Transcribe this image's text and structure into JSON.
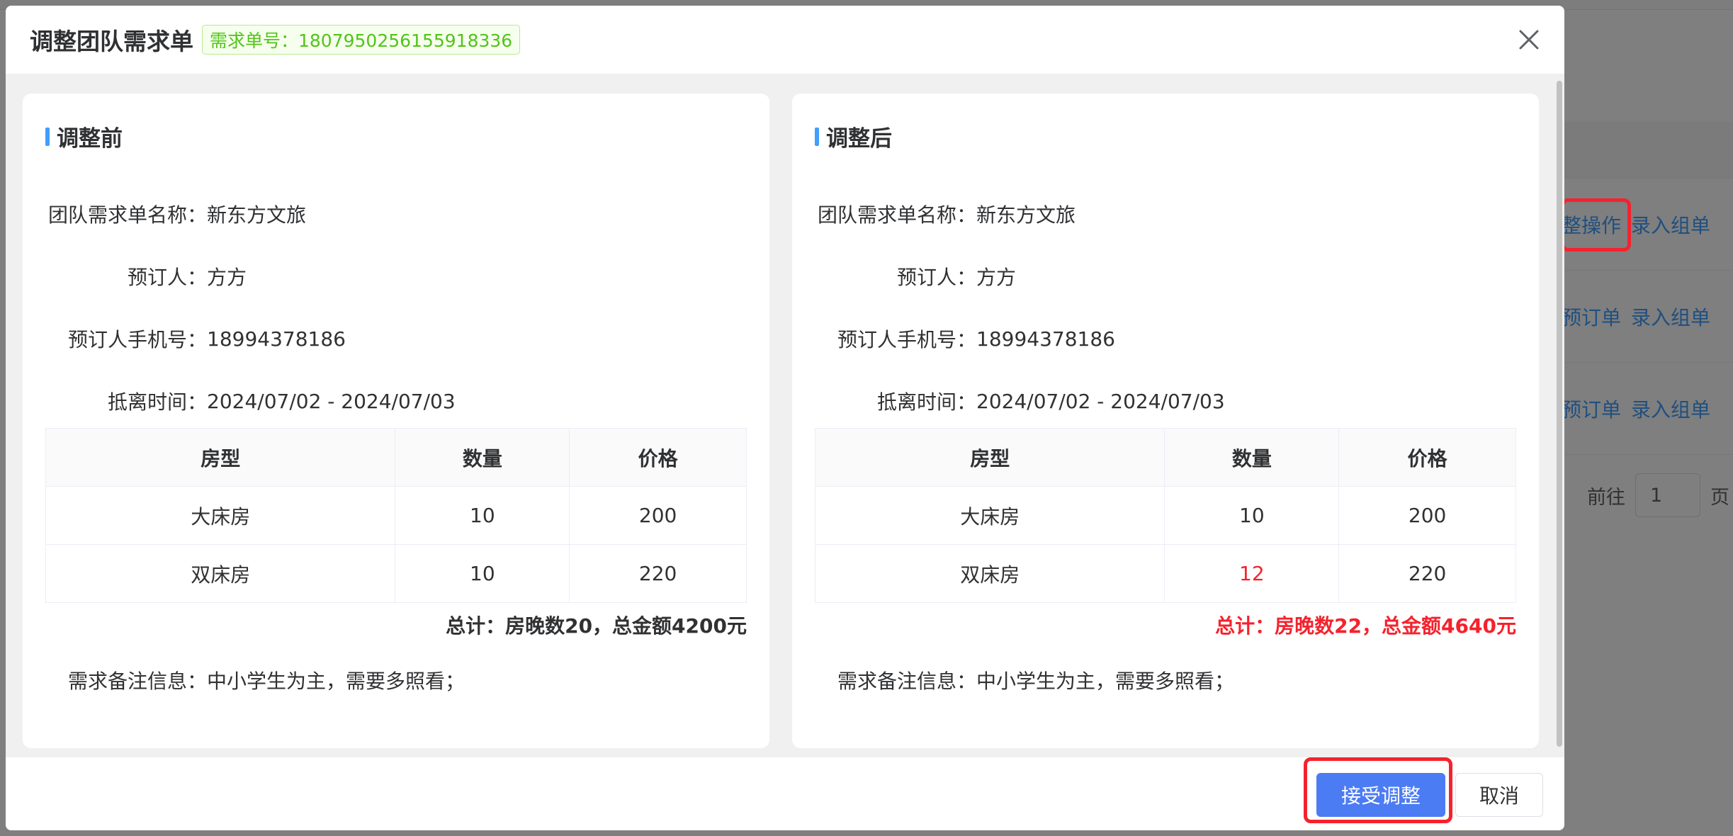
{
  "dialog": {
    "title": "调整团队需求单",
    "tag": "需求单号：1807950256155918336"
  },
  "before": {
    "section_title": "调整前",
    "fields": [
      {
        "label": "团队需求单名称：",
        "value": "新东方文旅"
      },
      {
        "label": "预订人：",
        "value": "方方"
      },
      {
        "label": "预订人手机号：",
        "value": "18994378186"
      },
      {
        "label": "抵离时间：",
        "value": "2024/07/02 - 2024/07/03"
      }
    ],
    "table": {
      "headers": [
        "房型",
        "数量",
        "价格"
      ],
      "rows": [
        [
          "大床房",
          "10",
          "200"
        ],
        [
          "双床房",
          "10",
          "220"
        ]
      ]
    },
    "total": "总计：房晚数20，总金额4200元",
    "remark": {
      "label": "需求备注信息：",
      "value": "中小学生为主，需要多照看；"
    }
  },
  "after": {
    "section_title": "调整后",
    "fields": [
      {
        "label": "团队需求单名称：",
        "value": "新东方文旅"
      },
      {
        "label": "预订人：",
        "value": "方方"
      },
      {
        "label": "预订人手机号：",
        "value": "18994378186"
      },
      {
        "label": "抵离时间：",
        "value": "2024/07/02 - 2024/07/03"
      }
    ],
    "table": {
      "headers": [
        "房型",
        "数量",
        "价格"
      ],
      "rows": [
        [
          "大床房",
          "10",
          "200"
        ],
        [
          "双床房",
          "12",
          "220"
        ]
      ]
    },
    "total": "总计：房晚数22，总金额4640元",
    "remark": {
      "label": "需求备注信息：",
      "value": "中小学生为主，需要多照看；"
    }
  },
  "footer": {
    "accept_label": "接受调整",
    "cancel_label": "取消"
  },
  "background": {
    "rows": [
      {
        "link1": "整操作",
        "link2": "录入组单"
      },
      {
        "link1": "预订单",
        "link2": "录入组单"
      },
      {
        "link1": "预订单",
        "link2": "录入组单"
      }
    ],
    "pager": {
      "goto_label": "前往",
      "page_value": "1",
      "page_suffix": "页"
    }
  },
  "colors": {
    "primary": "#4c7cf3",
    "accent_bar": "#409eff",
    "changed": "#f5222d",
    "tag_green": "#52c41a",
    "highlight_box": "#f5222d"
  }
}
